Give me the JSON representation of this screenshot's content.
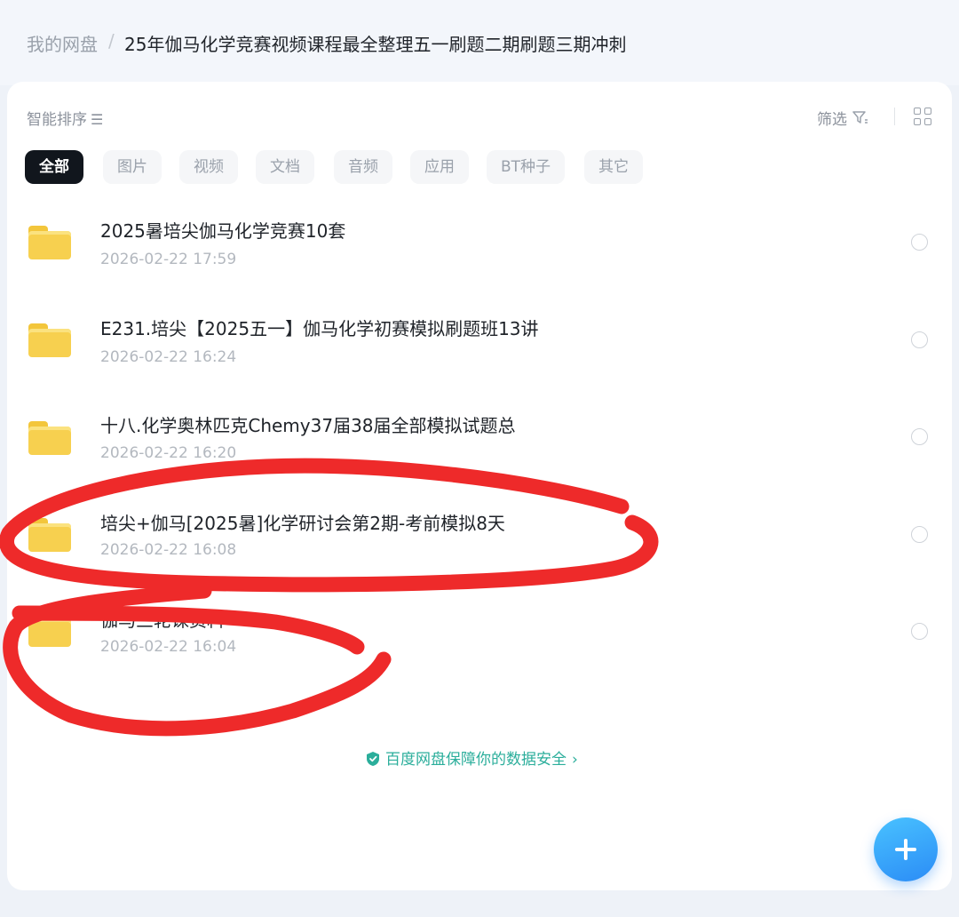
{
  "breadcrumb": {
    "root": "我的网盘",
    "separator": "/",
    "current": "25年伽马化学竞赛视频课程最全整理五一刷题二期刷题三期冲刺"
  },
  "toolbar": {
    "sort_label": "智能排序",
    "filter_label": "筛选"
  },
  "tabs": [
    {
      "label": "全部",
      "active": true
    },
    {
      "label": "图片",
      "active": false
    },
    {
      "label": "视频",
      "active": false
    },
    {
      "label": "文档",
      "active": false
    },
    {
      "label": "音频",
      "active": false
    },
    {
      "label": "应用",
      "active": false
    },
    {
      "label": "BT种子",
      "active": false
    },
    {
      "label": "其它",
      "active": false
    }
  ],
  "files": [
    {
      "name": "2025暑培尖伽马化学竞赛10套",
      "date": "2026-02-22  17:59",
      "icon": "folder-icon"
    },
    {
      "name": "E231.培尖【2025五一】伽马化学初赛模拟刷题班13讲",
      "date": "2026-02-22  16:24",
      "icon": "folder-icon"
    },
    {
      "name": "十八.化学奥林匹克Chemy37届38届全部模拟试题总",
      "date": "2026-02-22  16:20",
      "icon": "folder-icon"
    },
    {
      "name": "培尖+伽马[2025暑]化学研讨会第2期-考前模拟8天",
      "date": "2026-02-22  16:08",
      "icon": "folder-icon"
    },
    {
      "name": "伽马三轮课资料",
      "date": "2026-02-22  16:04",
      "icon": "folder-icon"
    }
  ],
  "footer": {
    "security_text": "百度网盘保障你的数据安全",
    "security_color": "#2bae9b"
  },
  "colors": {
    "accent": "#2b8cf6",
    "active_tab": "#11161d",
    "annotation": "#ee2a2a"
  }
}
